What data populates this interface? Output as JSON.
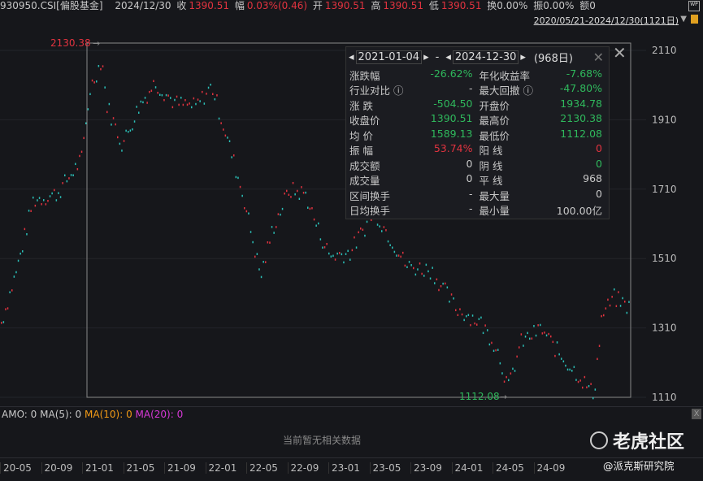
{
  "header": {
    "code": "930950.CSI[偏股基金]",
    "date": "2024/12/30",
    "close_label": "收",
    "close": "1390.51",
    "chg_label": "幅",
    "chg": "0.03%(0.46)",
    "open_label": "开",
    "open": "1390.51",
    "high_label": "高",
    "high": "1390.51",
    "low_label": "低",
    "low": "1390.51",
    "turnover": "换0.00%",
    "amplitude": "振0.00%",
    "amount": "额0",
    "range": "2020/05/21-2024/12/30(1121日)",
    "wp_icon": "WP"
  },
  "chart_data": {
    "type": "scatter",
    "y_ticks": [
      "2110",
      "1910",
      "1710",
      "1510",
      "1310",
      "1110"
    ],
    "ylim": [
      1110,
      2110
    ],
    "max_label": "2130.38",
    "min_label": "1112.08",
    "x_ticks": [
      "20-05",
      "20-09",
      "21-01",
      "21-05",
      "21-09",
      "22-01",
      "22-05",
      "22-09",
      "23-01",
      "23-05",
      "23-09",
      "24-01",
      "24-05",
      "24-09"
    ],
    "price_path": [
      [
        0,
        1320
      ],
      [
        20,
        1480
      ],
      [
        40,
        1680
      ],
      [
        70,
        1700
      ],
      [
        100,
        1800
      ],
      [
        110,
        2000
      ],
      [
        125,
        2090
      ],
      [
        130,
        1960
      ],
      [
        150,
        1840
      ],
      [
        170,
        1950
      ],
      [
        190,
        2020
      ],
      [
        215,
        1960
      ],
      [
        240,
        1950
      ],
      [
        260,
        2010
      ],
      [
        280,
        1850
      ],
      [
        300,
        1680
      ],
      [
        320,
        1460
      ],
      [
        335,
        1600
      ],
      [
        355,
        1710
      ],
      [
        375,
        1700
      ],
      [
        390,
        1600
      ],
      [
        405,
        1520
      ],
      [
        430,
        1530
      ],
      [
        445,
        1590
      ],
      [
        460,
        1650
      ],
      [
        480,
        1570
      ],
      [
        500,
        1490
      ],
      [
        530,
        1480
      ],
      [
        560,
        1370
      ],
      [
        590,
        1330
      ],
      [
        610,
        1260
      ],
      [
        625,
        1140
      ],
      [
        640,
        1270
      ],
      [
        665,
        1310
      ],
      [
        690,
        1230
      ],
      [
        710,
        1180
      ],
      [
        730,
        1120
      ],
      [
        740,
        1350
      ],
      [
        755,
        1400
      ],
      [
        775,
        1370
      ]
    ],
    "up_color": "#e2333f",
    "down_color": "#2bc0b8"
  },
  "panel": {
    "start": "2021-01-04",
    "sep": "-",
    "end": "2024-12-30",
    "days": "(968日)",
    "rows": [
      [
        "涨跌幅",
        "-26.62%",
        "g",
        "年化收益率",
        "-7.68%",
        "g"
      ],
      [
        "行业对比 ⓘ",
        "-",
        "w",
        "最大回撤 ⓘ",
        "-47.80%",
        "g"
      ],
      [
        "涨 跌",
        "-504.50",
        "g",
        "开盘价",
        "1934.78",
        "g"
      ],
      [
        "收盘价",
        "1390.51",
        "g",
        "最高价",
        "2130.38",
        "g"
      ],
      [
        "均 价",
        "1589.13",
        "g",
        "最低价",
        "1112.08",
        "g"
      ],
      [
        "振 幅",
        "53.74%",
        "r",
        "阳 线",
        "0",
        "r"
      ],
      [
        "成交额",
        "0",
        "w",
        "阴 线",
        "0",
        "g"
      ],
      [
        "成交量",
        "0",
        "w",
        "平 线",
        "968",
        "w"
      ],
      [
        "区间换手",
        "-",
        "w",
        "最大量",
        "0",
        "w"
      ],
      [
        "日均换手",
        "-",
        "w",
        "最小量",
        "100.00亿",
        "w"
      ]
    ]
  },
  "ma": {
    "amo": "AMO: 0",
    "ma5": "MA(5): 0",
    "ma10": "MA(10): 0",
    "ma20": "MA(20): 0"
  },
  "volume": {
    "no_data": "当前暂无相关数据"
  },
  "watermark": {
    "brand": "老虎社区",
    "author": "@派克斯研究院"
  }
}
